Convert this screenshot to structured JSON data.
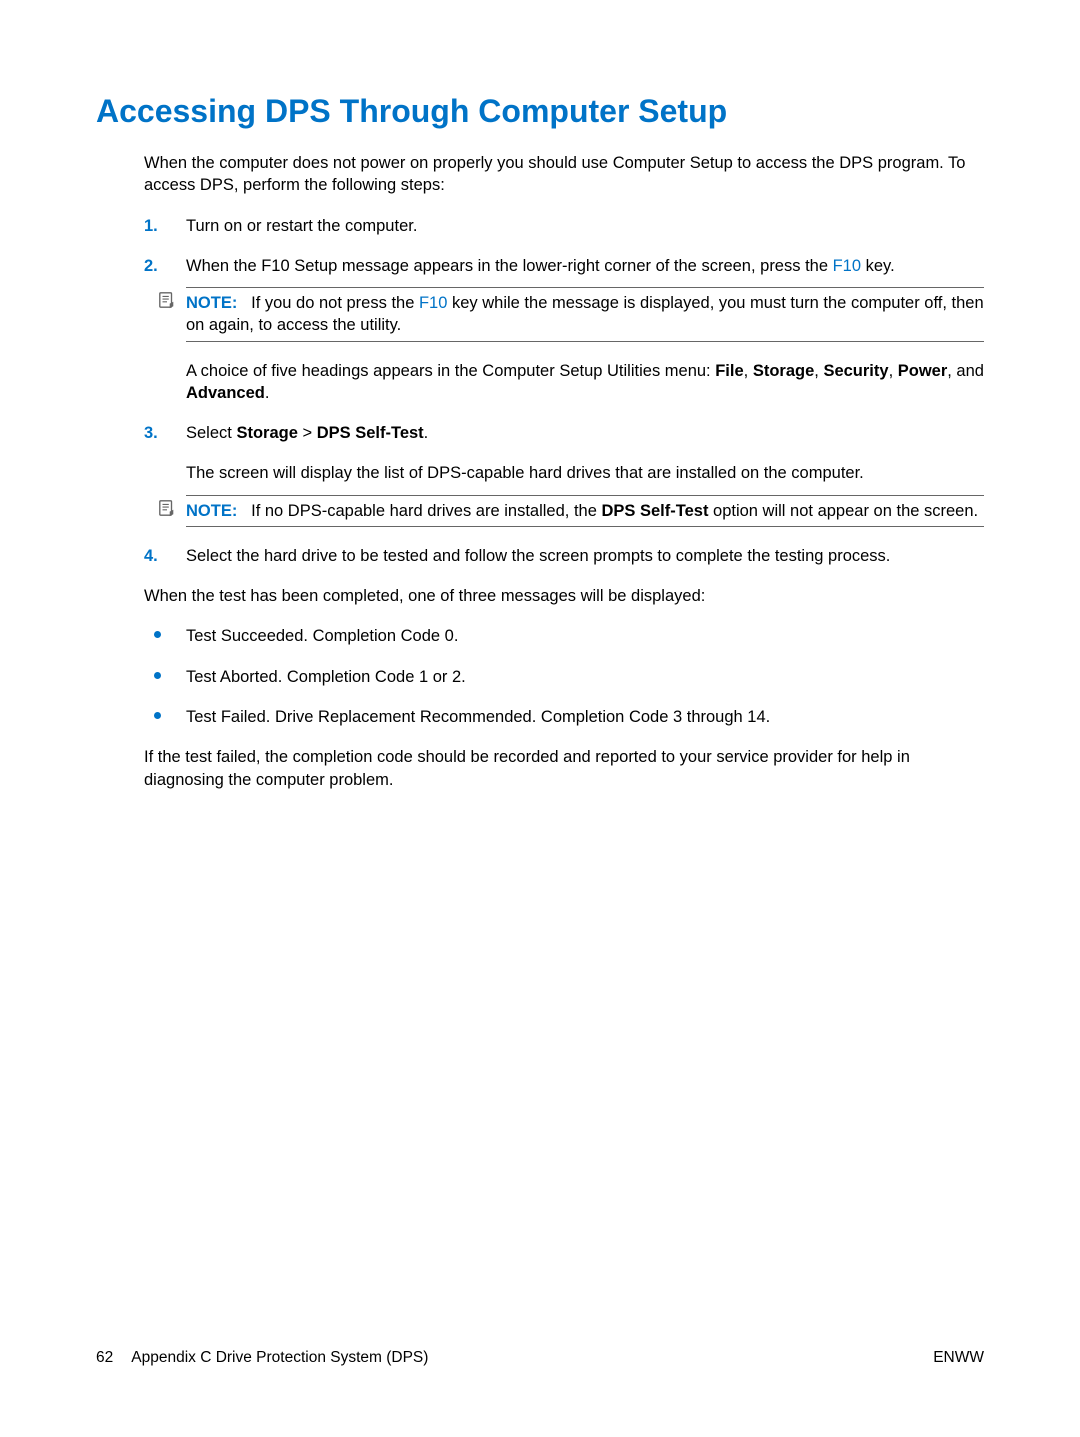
{
  "title": "Accessing DPS Through Computer Setup",
  "intro": "When the computer does not power on properly you should use Computer Setup to access the DPS program. To access DPS, perform the following steps:",
  "steps": {
    "s1": {
      "num": "1.",
      "text": "Turn on or restart the computer."
    },
    "s2": {
      "num": "2.",
      "pre": "When the F10 Setup message appears in the lower-right corner of the screen, press the ",
      "link": "F10",
      "post": " key.",
      "note_label": "NOTE:",
      "note_pre": "If you do not press the ",
      "note_link": "F10",
      "note_post": " key while the message is displayed, you must turn the computer off, then on again, to access the utility.",
      "choice_pre": "A choice of five headings appears in the Computer Setup Utilities menu: ",
      "menu1": "File",
      "sep1": ", ",
      "menu2": "Storage",
      "sep2": ", ",
      "menu3": "Security",
      "sep3": ", ",
      "menu4": "Power",
      "sep4": ", and ",
      "menu5": "Advanced",
      "choice_end": "."
    },
    "s3": {
      "num": "3.",
      "pre": "Select ",
      "b1": "Storage",
      "mid": " > ",
      "b2": "DPS Self-Test",
      "post": ".",
      "sub": "The screen will display the list of DPS-capable hard drives that are installed on the computer.",
      "note_label": "NOTE:",
      "note_pre": "If no DPS-capable hard drives are installed, the ",
      "note_bold": "DPS Self-Test",
      "note_post": " option will not appear on the screen."
    },
    "s4": {
      "num": "4.",
      "text": "Select the hard drive to be tested and follow the screen prompts to complete the testing process."
    }
  },
  "after_list": "When the test has been completed, one of three messages will be displayed:",
  "bullets": {
    "b1": "Test Succeeded. Completion Code 0.",
    "b2": "Test Aborted. Completion Code 1 or 2.",
    "b3": "Test Failed. Drive Replacement Recommended. Completion Code 3 through 14."
  },
  "closing": "If the test failed, the completion code should be recorded and reported to your service provider for help in diagnosing the computer problem.",
  "footer": {
    "page": "62",
    "appendix": "Appendix C   Drive Protection System (DPS)",
    "right": "ENWW"
  }
}
